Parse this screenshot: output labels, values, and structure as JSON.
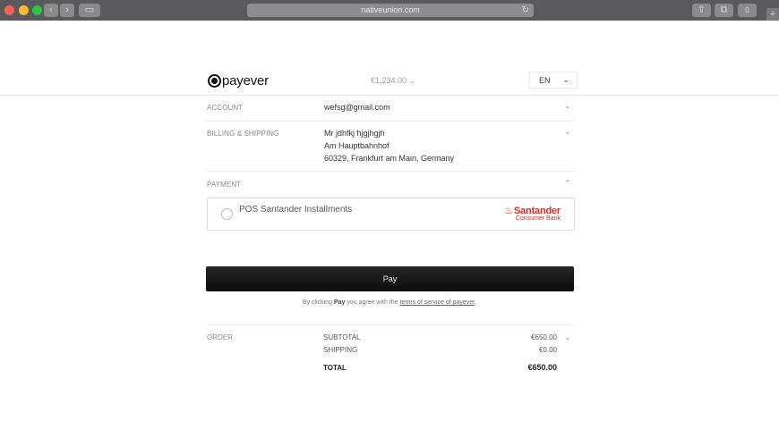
{
  "browser": {
    "url": "nativeunion.com",
    "back_glyph": "‹",
    "forward_glyph": "›",
    "sidebar_glyph": "▭",
    "reload_glyph": "↻",
    "share_glyph": "⇧",
    "tabs_glyph": "⧉",
    "extension_badge": "0",
    "new_tab_glyph": "+"
  },
  "header": {
    "logo_text": "payever",
    "amount": "€1,234.00",
    "amount_chevron": "⌄",
    "language": "EN",
    "language_chevron": "⌄"
  },
  "account": {
    "label": "ACCOUNT",
    "email": "wefsg@gmail.com",
    "chevron": "⌄"
  },
  "billing": {
    "label": "BILLING & SHIPPING",
    "name": "Mr jdhfkj hjgjhgjh",
    "street": "Am Hauptbahnhof",
    "city": "60329, Frankfurt am Main, Germany",
    "chevron": "⌄"
  },
  "payment": {
    "label": "PAYMENT",
    "chevron": "⌃",
    "option_name": "POS Santander Installments",
    "brand_icon": "santander-flame-icon",
    "brand_name": "Santander",
    "brand_sub": "Consumer Bank",
    "brand_color": "#e2261e"
  },
  "pay_button": "Pay",
  "terms": {
    "prefix": "By clicking ",
    "button_ref": "Pay",
    "middle": " you agree with the ",
    "link": "terms of service of payever",
    "suffix": "."
  },
  "order": {
    "label": "ORDER",
    "chevron": "⌄",
    "subtotal_label": "SUBTOTAL",
    "subtotal": "€650.00",
    "shipping_label": "SHIPPING",
    "shipping": "€0.00",
    "total_label": "TOTAL",
    "total": "€650.00"
  }
}
